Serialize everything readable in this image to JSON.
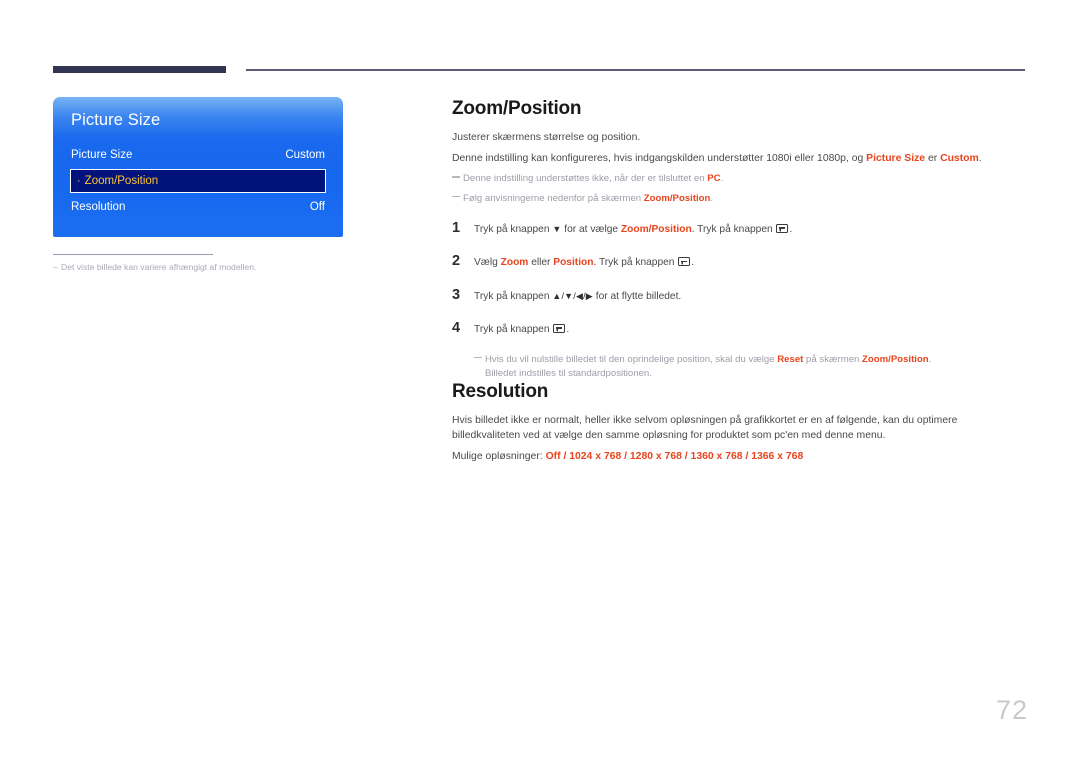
{
  "page": {
    "number": "72"
  },
  "osd": {
    "title": "Picture Size",
    "rows": [
      {
        "label": "Picture Size",
        "value": "Custom",
        "selected": false
      },
      {
        "label": "Zoom/Position",
        "value": "",
        "selected": true,
        "bullet": "·"
      },
      {
        "label": "Resolution",
        "value": "Off",
        "selected": false
      }
    ],
    "note": "Det viste billede kan variere afhængigt af modellen."
  },
  "sections": [
    {
      "title": "Zoom/Position",
      "intro": "Justerer skærmens størrelse og position.",
      "desc_pre": "Denne indstilling kan konfigureres, hvis indgangskilden understøtter 1080i eller 1080p, og ",
      "desc_hl1": "Picture Size",
      "desc_mid": " er ",
      "desc_hl2": "Custom",
      "desc_post": ".",
      "note1_pre": "Denne indstilling understøttes ikke, når der er tilsluttet en ",
      "note1_hl": "PC",
      "note1_post": ".",
      "note2_pre": "Følg anvisningerne nedenfor på skærmen ",
      "note2_hl": "Zoom/Position",
      "note2_post": ".",
      "steps": [
        {
          "num": "1",
          "t1": "Tryk på knappen ",
          "glyph1": "▼",
          "t2": " for at vælge ",
          "hl1": "Zoom/Position",
          "t3": ". Tryk på knappen ",
          "t4": "."
        },
        {
          "num": "2",
          "t1": "Vælg ",
          "hl1": "Zoom",
          "t2": " eller ",
          "hl2": "Position",
          "t3": ". Tryk på knappen ",
          "t4": "."
        },
        {
          "num": "3",
          "t1": "Tryk på knappen ",
          "glyph1": "▲/▼/◀/▶",
          "t2": " for at flytte billedet."
        },
        {
          "num": "4",
          "t1": "Tryk på knappen ",
          "t4": "."
        }
      ],
      "endnote_pre": "Hvis du vil nulstille billedet til den oprindelige position, skal du vælge ",
      "endnote_hl1": "Reset",
      "endnote_mid": " på skærmen ",
      "endnote_hl2": "Zoom/Position",
      "endnote_post": ".",
      "endnote_line2": "Billedet indstilles til standardpositionen."
    },
    {
      "title": "Resolution",
      "desc": "Hvis billedet ikke er normalt, heller ikke selvom opløsningen på grafikkortet er en af følgende, kan du optimere billedkvaliteten ved at vælge den samme opløsning for produktet som pc'en med denne menu.",
      "options_label": "Mulige opløsninger: ",
      "options": "Off / 1024 x 768 / 1280 x 768 / 1360 x 768 / 1366 x 768"
    }
  ],
  "colors": {
    "accent": "#e8441e",
    "osd_highlight_bg": "#00127c",
    "osd_highlight_text": "#ffc62e",
    "rule": "#323551"
  }
}
